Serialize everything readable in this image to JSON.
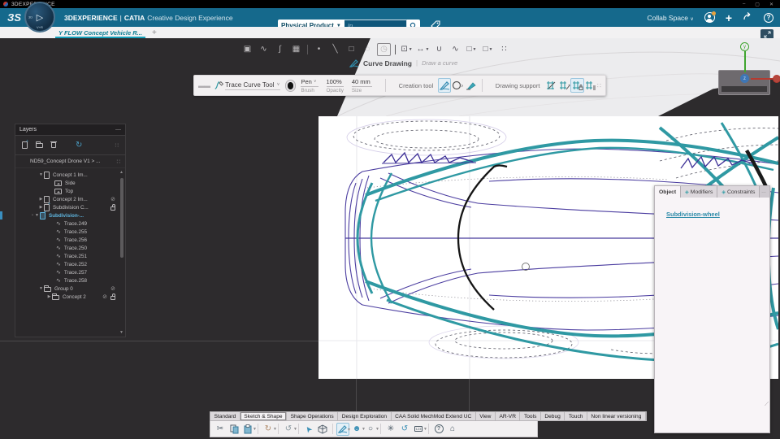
{
  "window": {
    "title": "3DEXPERIENCE",
    "minimize": "–",
    "maximize": "▢",
    "close": "✕"
  },
  "header": {
    "brand": "3DEXPERIENCE",
    "divider": "|",
    "app": "CATIA",
    "app_desc": "Creative Design Experience",
    "search": {
      "scope": "Physical Product",
      "placeholder": "In"
    },
    "collab": "Collab Space",
    "compass_play": "▷",
    "compass_vr": "V+R",
    "compass_3d": "3D"
  },
  "tabstrip": {
    "active_tab": "Y FLOW Concept Vehicle R...",
    "new_tab": "+"
  },
  "action_bar": {
    "tool_label": "Curve Drawing",
    "tool_hint": "Draw a curve"
  },
  "trace_toolbar": {
    "tool_name": "Trace Curve Tool",
    "brush_value": "Pen",
    "brush_label": "Brush",
    "opacity_value": "100%",
    "opacity_label": "Opacity",
    "size_value": "40 mm",
    "size_label": "Size",
    "creation_label": "Creation tool",
    "support_label": "Drawing support"
  },
  "layers_panel": {
    "title": "Layers",
    "breadcrumb": "ND59_Concept Drone V1 > ...",
    "rows": [
      {
        "label": "Concept 1 Im..."
      },
      {
        "label": "Side"
      },
      {
        "label": "Top"
      },
      {
        "label": "Concept 2 Im..."
      },
      {
        "label": "Subdivision C..."
      },
      {
        "label": "Subdivision-..."
      },
      {
        "label": "Trace.249"
      },
      {
        "label": "Trace.255"
      },
      {
        "label": "Trace.256"
      },
      {
        "label": "Trace.250"
      },
      {
        "label": "Trace.251"
      },
      {
        "label": "Trace.252"
      },
      {
        "label": "Trace.257"
      },
      {
        "label": "Trace.258"
      },
      {
        "label": "Group 0"
      },
      {
        "label": "Concept 2"
      }
    ]
  },
  "object_panel": {
    "tab_object": "Object",
    "tab_modifiers": "Modifiers",
    "tab_constraints": "Constraints",
    "link": "Subdivision-wheel"
  },
  "bottom_tabs": {
    "items": [
      "Standard",
      "Sketch & Shape",
      "Shape Operations",
      "Design Exploration",
      "CAA Solid MechMod Extend UC",
      "View",
      "AR-VR",
      "Tools",
      "Debug",
      "Touch",
      "Non linear versioning"
    ],
    "active": "Sketch & Shape"
  },
  "colors": {
    "header_blue": "#15698c",
    "accent_teal": "#2f99a3",
    "trace_purple": "#4b3da0",
    "selection_blue": "#58b0dc",
    "tab_underline": "#17a0ba"
  }
}
